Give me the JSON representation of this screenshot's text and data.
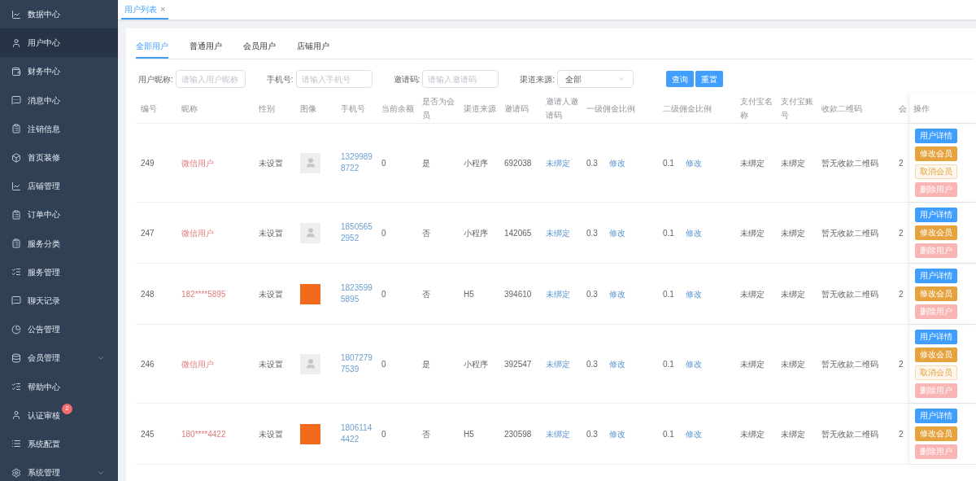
{
  "sidebar": {
    "items": [
      {
        "label": "数据中心",
        "selected": false
      },
      {
        "label": "用户中心",
        "selected": true
      },
      {
        "label": "财务中心",
        "selected": false
      },
      {
        "label": "消息中心",
        "selected": false
      },
      {
        "label": "注销信息",
        "selected": false
      },
      {
        "label": "首页装修",
        "selected": false
      },
      {
        "label": "店铺管理",
        "selected": false
      },
      {
        "label": "订单中心",
        "selected": false
      },
      {
        "label": "服务分类",
        "selected": false
      },
      {
        "label": "服务管理",
        "selected": false
      },
      {
        "label": "聊天记录",
        "selected": false
      },
      {
        "label": "公告管理",
        "selected": false
      },
      {
        "label": "会员管理",
        "selected": false,
        "expanded": false
      },
      {
        "label": "帮助中心",
        "selected": false
      },
      {
        "label": "认证审核",
        "selected": false,
        "badge": "2"
      },
      {
        "label": "系统配置",
        "selected": false
      },
      {
        "label": "系统管理",
        "selected": false,
        "expanded": false
      }
    ]
  },
  "page_tabs": [
    {
      "label": "用户列表",
      "close": "×",
      "selected": true
    }
  ],
  "user_tabs": [
    {
      "label": "全部用户",
      "selected": true
    },
    {
      "label": "普通用户",
      "selected": false
    },
    {
      "label": "会员用户",
      "selected": false
    },
    {
      "label": "店铺用户",
      "selected": false
    }
  ],
  "filters": [
    {
      "kind": "input",
      "label": "用户昵称:",
      "placeholder": "请输入用户昵称"
    },
    {
      "kind": "input",
      "label": "手机号:",
      "placeholder": "请输入手机号"
    },
    {
      "kind": "input",
      "label": "邀请码:",
      "placeholder": "请输入邀请码"
    },
    {
      "kind": "select",
      "label": "渠道来源:",
      "value": "全部"
    }
  ],
  "filter_buttons": [
    "查询",
    "重置"
  ],
  "table": {
    "columns": [
      "编号",
      "昵称",
      "性别",
      "图像",
      "手机号",
      "当前余额",
      "是否为会员",
      "渠道来源",
      "邀请码",
      "邀请人邀请码",
      "一级佣金比例",
      "二级佣金比例",
      "支付宝名称",
      "支付宝账号",
      "收款二维码",
      "会"
    ],
    "actions_column": "操作",
    "rows": [
      {
        "id": "249",
        "nickname": "微信用户",
        "gender": "未设置",
        "avatar": {
          "kind": "default"
        },
        "phone": "13299898722",
        "balance": "0",
        "is_member": "是",
        "channel": "小程序",
        "invite_code": "692038",
        "inviter_code": "未绑定",
        "level1_ratio": "0.3",
        "level1_edit": "修改",
        "level2_ratio": "0.1",
        "level2_edit": "修改",
        "alipay_name": "未绑定",
        "alipay_account": "未绑定",
        "qr_code": "暂无收款二维码",
        "column_16": "2",
        "actions": [
          {
            "kind": "detail",
            "label": "用户详情"
          },
          {
            "kind": "edit_member",
            "label": "修改会员"
          },
          {
            "kind": "cancel_member",
            "label": "取消会员"
          },
          {
            "kind": "delete",
            "label": "删除用户"
          }
        ]
      },
      {
        "id": "247",
        "nickname": "微信用户",
        "gender": "未设置",
        "avatar": {
          "kind": "default"
        },
        "phone": "18505652952",
        "balance": "0",
        "is_member": "否",
        "channel": "小程序",
        "invite_code": "142065",
        "inviter_code": "未绑定",
        "level1_ratio": "0.3",
        "level1_edit": "修改",
        "level2_ratio": "0.1",
        "level2_edit": "修改",
        "alipay_name": "未绑定",
        "alipay_account": "未绑定",
        "qr_code": "暂无收款二维码",
        "column_16": "2",
        "actions": [
          {
            "kind": "detail",
            "label": "用户详情"
          },
          {
            "kind": "edit_member",
            "label": "修改会员"
          },
          {
            "kind": "delete",
            "label": "删除用户"
          }
        ]
      },
      {
        "id": "248",
        "nickname": "182****5895",
        "gender": "未设置",
        "avatar": {
          "kind": "image"
        },
        "phone": "18235995895",
        "balance": "0",
        "is_member": "否",
        "channel": "H5",
        "invite_code": "394610",
        "inviter_code": "未绑定",
        "level1_ratio": "0.3",
        "level1_edit": "修改",
        "level2_ratio": "0.1",
        "level2_edit": "修改",
        "alipay_name": "未绑定",
        "alipay_account": "未绑定",
        "qr_code": "暂无收款二维码",
        "column_16": "2",
        "actions": [
          {
            "kind": "detail",
            "label": "用户详情"
          },
          {
            "kind": "edit_member",
            "label": "修改会员"
          },
          {
            "kind": "delete",
            "label": "删除用户"
          }
        ]
      },
      {
        "id": "246",
        "nickname": "微信用户",
        "gender": "未设置",
        "avatar": {
          "kind": "default"
        },
        "phone": "18072797539",
        "balance": "0",
        "is_member": "是",
        "channel": "小程序",
        "invite_code": "392547",
        "inviter_code": "未绑定",
        "level1_ratio": "0.3",
        "level1_edit": "修改",
        "level2_ratio": "0.1",
        "level2_edit": "修改",
        "alipay_name": "未绑定",
        "alipay_account": "未绑定",
        "qr_code": "暂无收款二维码",
        "column_16": "2",
        "actions": [
          {
            "kind": "detail",
            "label": "用户详情"
          },
          {
            "kind": "edit_member",
            "label": "修改会员"
          },
          {
            "kind": "cancel_member",
            "label": "取消会员"
          },
          {
            "kind": "delete",
            "label": "删除用户"
          }
        ]
      },
      {
        "id": "245",
        "nickname": "180****4422",
        "gender": "未设置",
        "avatar": {
          "kind": "image"
        },
        "phone": "18061144422",
        "balance": "0",
        "is_member": "否",
        "channel": "H5",
        "invite_code": "230598",
        "inviter_code": "未绑定",
        "level1_ratio": "0.3",
        "level1_edit": "修改",
        "level2_ratio": "0.1",
        "level2_edit": "修改",
        "alipay_name": "未绑定",
        "alipay_account": "未绑定",
        "qr_code": "暂无收款二维码",
        "column_16": "2",
        "actions": [
          {
            "kind": "detail",
            "label": "用户详情"
          },
          {
            "kind": "edit_member",
            "label": "修改会员"
          },
          {
            "kind": "delete",
            "label": "删除用户"
          }
        ]
      }
    ]
  }
}
